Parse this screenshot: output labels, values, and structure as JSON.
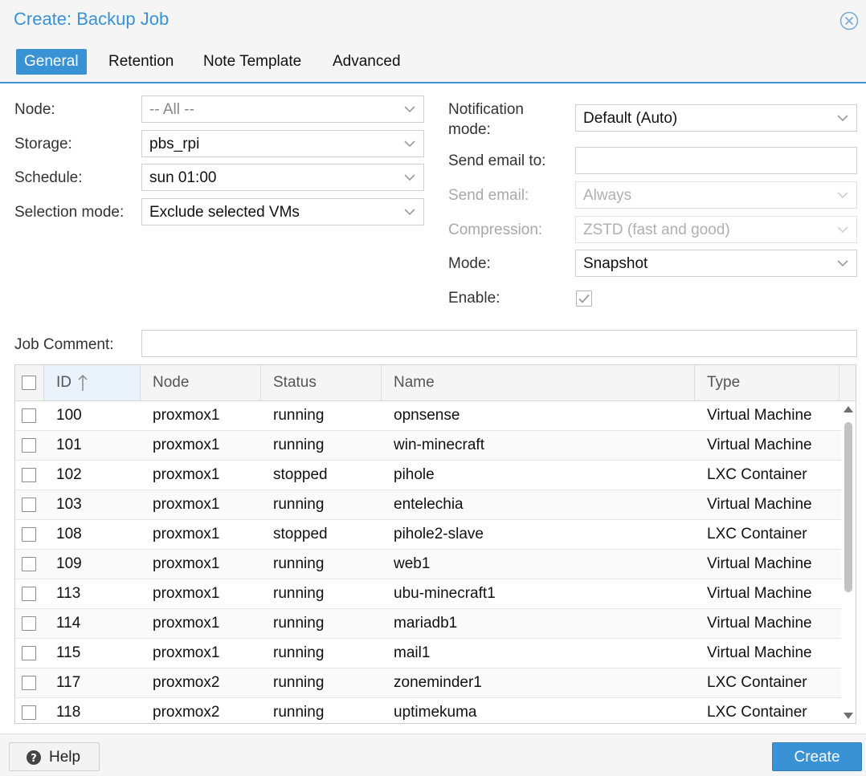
{
  "dialog": {
    "title": "Create: Backup Job",
    "tabs": [
      {
        "label": "General",
        "active": true
      },
      {
        "label": "Retention",
        "active": false
      },
      {
        "label": "Note Template",
        "active": false
      },
      {
        "label": "Advanced",
        "active": false
      }
    ]
  },
  "form": {
    "node": {
      "label": "Node:",
      "value": "-- All --"
    },
    "storage": {
      "label": "Storage:",
      "value": "pbs_rpi"
    },
    "schedule": {
      "label": "Schedule:",
      "value": "sun 01:00"
    },
    "selection_mode": {
      "label": "Selection mode:",
      "value": "Exclude selected VMs"
    },
    "notification_mode": {
      "label_line1": "Notification",
      "label_line2": "mode:",
      "value": "Default (Auto)"
    },
    "send_email_to": {
      "label": "Send email to:",
      "value": ""
    },
    "send_email": {
      "label": "Send email:",
      "value": "Always"
    },
    "compression": {
      "label": "Compression:",
      "value": "ZSTD (fast and good)"
    },
    "mode": {
      "label": "Mode:",
      "value": "Snapshot"
    },
    "enable": {
      "label": "Enable:",
      "checked": true
    },
    "job_comment": {
      "label": "Job Comment:",
      "value": ""
    }
  },
  "grid": {
    "columns": {
      "id": "ID",
      "node": "Node",
      "status": "Status",
      "name": "Name",
      "type": "Type"
    },
    "rows": [
      {
        "id": "100",
        "node": "proxmox1",
        "status": "running",
        "name": "opnsense",
        "type": "Virtual Machine"
      },
      {
        "id": "101",
        "node": "proxmox1",
        "status": "running",
        "name": "win-minecraft",
        "type": "Virtual Machine"
      },
      {
        "id": "102",
        "node": "proxmox1",
        "status": "stopped",
        "name": "pihole",
        "type": "LXC Container"
      },
      {
        "id": "103",
        "node": "proxmox1",
        "status": "running",
        "name": "entelechia",
        "type": "Virtual Machine"
      },
      {
        "id": "108",
        "node": "proxmox1",
        "status": "stopped",
        "name": "pihole2-slave",
        "type": "LXC Container"
      },
      {
        "id": "109",
        "node": "proxmox1",
        "status": "running",
        "name": "web1",
        "type": "Virtual Machine"
      },
      {
        "id": "113",
        "node": "proxmox1",
        "status": "running",
        "name": "ubu-minecraft1",
        "type": "Virtual Machine"
      },
      {
        "id": "114",
        "node": "proxmox1",
        "status": "running",
        "name": "mariadb1",
        "type": "Virtual Machine"
      },
      {
        "id": "115",
        "node": "proxmox1",
        "status": "running",
        "name": "mail1",
        "type": "Virtual Machine"
      },
      {
        "id": "117",
        "node": "proxmox2",
        "status": "running",
        "name": "zoneminder1",
        "type": "LXC Container"
      },
      {
        "id": "118",
        "node": "proxmox2",
        "status": "running",
        "name": "uptimekuma",
        "type": "LXC Container"
      }
    ]
  },
  "footer": {
    "help_label": "Help",
    "create_label": "Create"
  },
  "colors": {
    "accent": "#3892d4",
    "disabled_text": "#a8a8a8"
  },
  "icons": {
    "close": "close-circle-icon",
    "help": "question-circle-icon",
    "sort": "sort-arrow-up-icon",
    "dropdown": "chevron-down-icon",
    "check": "checkmark-icon"
  }
}
